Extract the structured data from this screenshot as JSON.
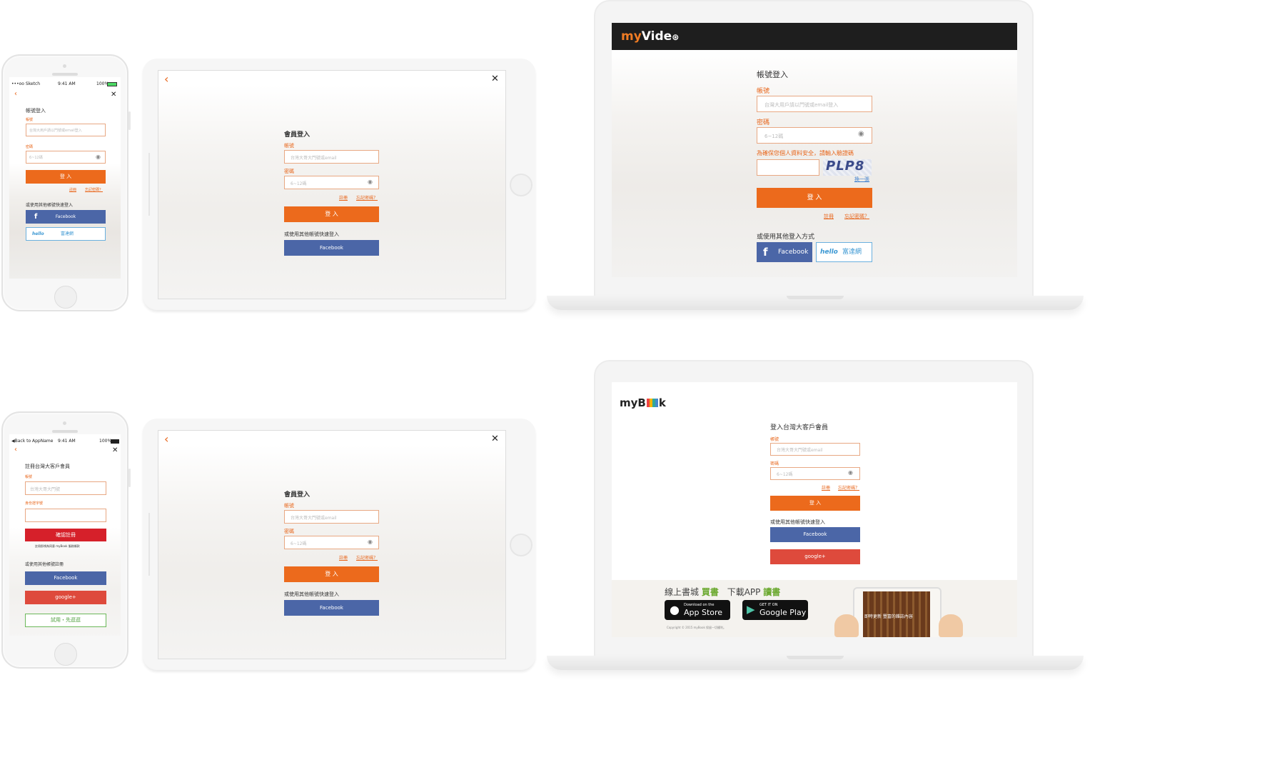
{
  "phone_top": {
    "status_carrier": "•••oo Sketch",
    "status_time": "9:41 AM",
    "status_battery": "100%",
    "title": "帳號登入",
    "account_label": "帳號",
    "account_placeholder": "台灣大用戶請以門號或email登入",
    "password_label": "密碼",
    "password_placeholder": "6~12碼",
    "login_button": "登 入",
    "register_link": "註冊",
    "forgot_link": "忘記密碼？",
    "alt_login_title": "或使用其他帳號快速登入",
    "facebook_button": "Facebook",
    "hello_logo": "hello",
    "hello_button": "富達網"
  },
  "tablet_top": {
    "title": "會員登入",
    "account_label": "帳號",
    "account_placeholder": "台灣大哥大門號或email",
    "password_label": "密碼",
    "password_placeholder": "6~12碼",
    "register_link": "註冊",
    "forgot_link": "忘記密碼？",
    "login_button": "登 入",
    "alt_login_title": "或使用其他帳號快速登入",
    "facebook_button": "Facebook"
  },
  "laptop_top": {
    "logo_prefix": "my",
    "logo_suffix": "Vide",
    "title": "帳號登入",
    "account_label": "帳號",
    "account_placeholder": "台灣大用戶請以門號或email登入",
    "password_label": "密碼",
    "password_placeholder": "6~12碼",
    "captcha_label": "為確保您個人資料安全，請輸入驗證碼",
    "captcha_text": "PLP8",
    "captcha_refresh": "換一張",
    "login_button": "登 入",
    "register_link": "註冊",
    "forgot_link": "忘記密碼？",
    "alt_login_title": "或使用其他登入方式",
    "facebook_button": "Facebook",
    "hello_logo": "hello",
    "hello_button": "富達網"
  },
  "phone_bottom": {
    "status_back": "◀Back to AppName",
    "status_time": "9:41 AM",
    "status_battery": "100%",
    "title": "註冊台灣大客戶會員",
    "account_label": "帳號",
    "account_placeholder": "台灣大哥大門號",
    "id_label": "身份證字號",
    "confirm_button": "確認註冊",
    "terms_text": "註冊即視為同意 myBook 服務條款",
    "alt_title": "或使用其他帳號註冊",
    "facebook_button": "Facebook",
    "google_button": "google+",
    "trial_button": "試用・先逛逛"
  },
  "tablet_bottom": {
    "title": "會員登入",
    "account_label": "帳號",
    "account_placeholder": "台灣大哥大門號或email",
    "password_label": "密碼",
    "password_placeholder": "6~12碼",
    "register_link": "註冊",
    "forgot_link": "忘記密碼？",
    "login_button": "登 入",
    "alt_login_title": "或使用其他帳號快速登入",
    "facebook_button": "Facebook"
  },
  "laptop_bottom": {
    "logo_prefix": "myB",
    "logo_suffix": "k",
    "title": "登入台灣大客戶會員",
    "account_label": "帳號",
    "account_placeholder": "台灣大哥大門號或email",
    "password_label": "密碼",
    "password_placeholder": "6~12碼",
    "register_link": "註冊",
    "forgot_link": "忘記密碼？",
    "login_button": "登 入",
    "alt_login_title": "或使用其他帳號快速登入",
    "facebook_button": "Facebook",
    "google_button": "google+",
    "promo_text_1": "線上書城",
    "promo_highlight_1": "買書",
    "promo_text_2": "下載APP",
    "promo_highlight_2": "讀書",
    "appstore_small": "Download on the",
    "appstore_big": "App Store",
    "googleplay_small": "GET IT ON",
    "googleplay_big": "Google Play",
    "tablet_caption": "即時更新 豐富的雜誌內容",
    "copyright": "Copyright © 2015 myBook 保留一切權利。"
  },
  "colors": {
    "accent_orange": "#ec6a1c",
    "facebook_blue": "#4b66a7",
    "google_red": "#de4a3c",
    "confirm_red": "#d6202a",
    "header_dark": "#1e1e1e",
    "promo_green": "#6aa82e"
  }
}
